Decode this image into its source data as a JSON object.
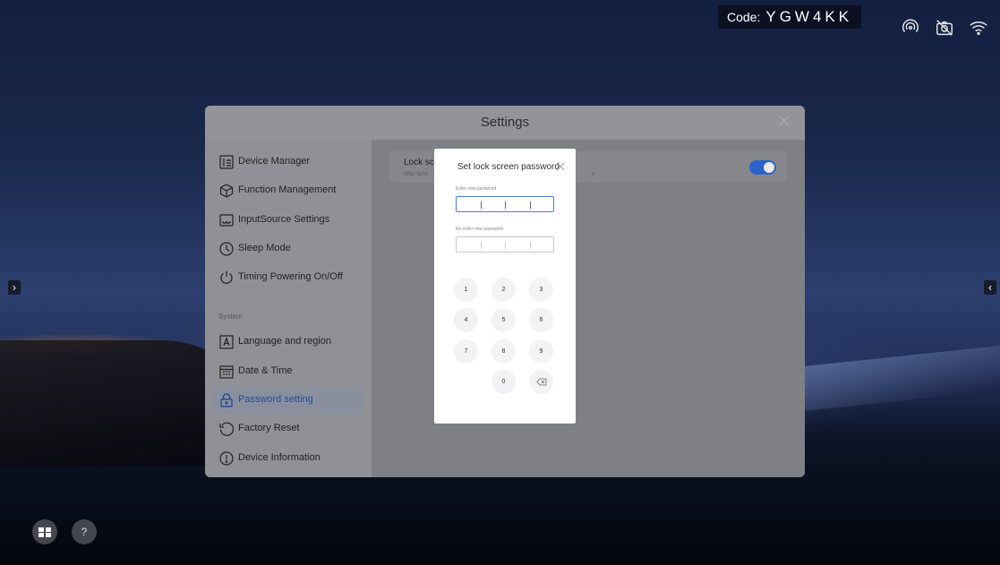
{
  "status": {
    "code_label": "Code:",
    "code_value": "YGW4KK",
    "icons": [
      "screen-cast-icon",
      "camera-off-icon",
      "wifi-icon"
    ]
  },
  "side_arrows": {
    "left": "›",
    "right": "‹"
  },
  "bottom_buttons": [
    "apps-icon",
    "help-icon"
  ],
  "settings": {
    "title": "Settings",
    "sidebar": {
      "items": [
        {
          "label": "Device Manager",
          "icon": "device-manager-icon"
        },
        {
          "label": "Function Management",
          "icon": "cube-icon"
        },
        {
          "label": "InputSource Settings",
          "icon": "input-source-icon"
        },
        {
          "label": "Sleep Mode",
          "icon": "clock-icon"
        },
        {
          "label": "Timing Powering On/Off",
          "icon": "power-icon"
        }
      ],
      "section_label": "System",
      "system_items": [
        {
          "label": "Language and region",
          "icon": "language-icon"
        },
        {
          "label": "Date & Time",
          "icon": "calendar-icon"
        },
        {
          "label": "Password setting",
          "icon": "lock-icon",
          "active": true
        },
        {
          "label": "Factory Reset",
          "icon": "reset-icon"
        },
        {
          "label": "Device Information",
          "icon": "info-icon"
        }
      ]
    },
    "lock_card": {
      "title": "Lock sc",
      "description": "After turni",
      "description_tail": "n",
      "toggle_on": true
    }
  },
  "dialog": {
    "title": "Set lock screen password",
    "new_password_label": "Enter new password",
    "reenter_label": "Re-enter new password",
    "keys": [
      "1",
      "2",
      "3",
      "4",
      "5",
      "6",
      "7",
      "8",
      "9",
      "0"
    ],
    "delete_key": "backspace-icon"
  },
  "colors": {
    "accent": "#2b63c8",
    "active_label": "#274b9a",
    "dialog_bg": "#ffffff"
  }
}
